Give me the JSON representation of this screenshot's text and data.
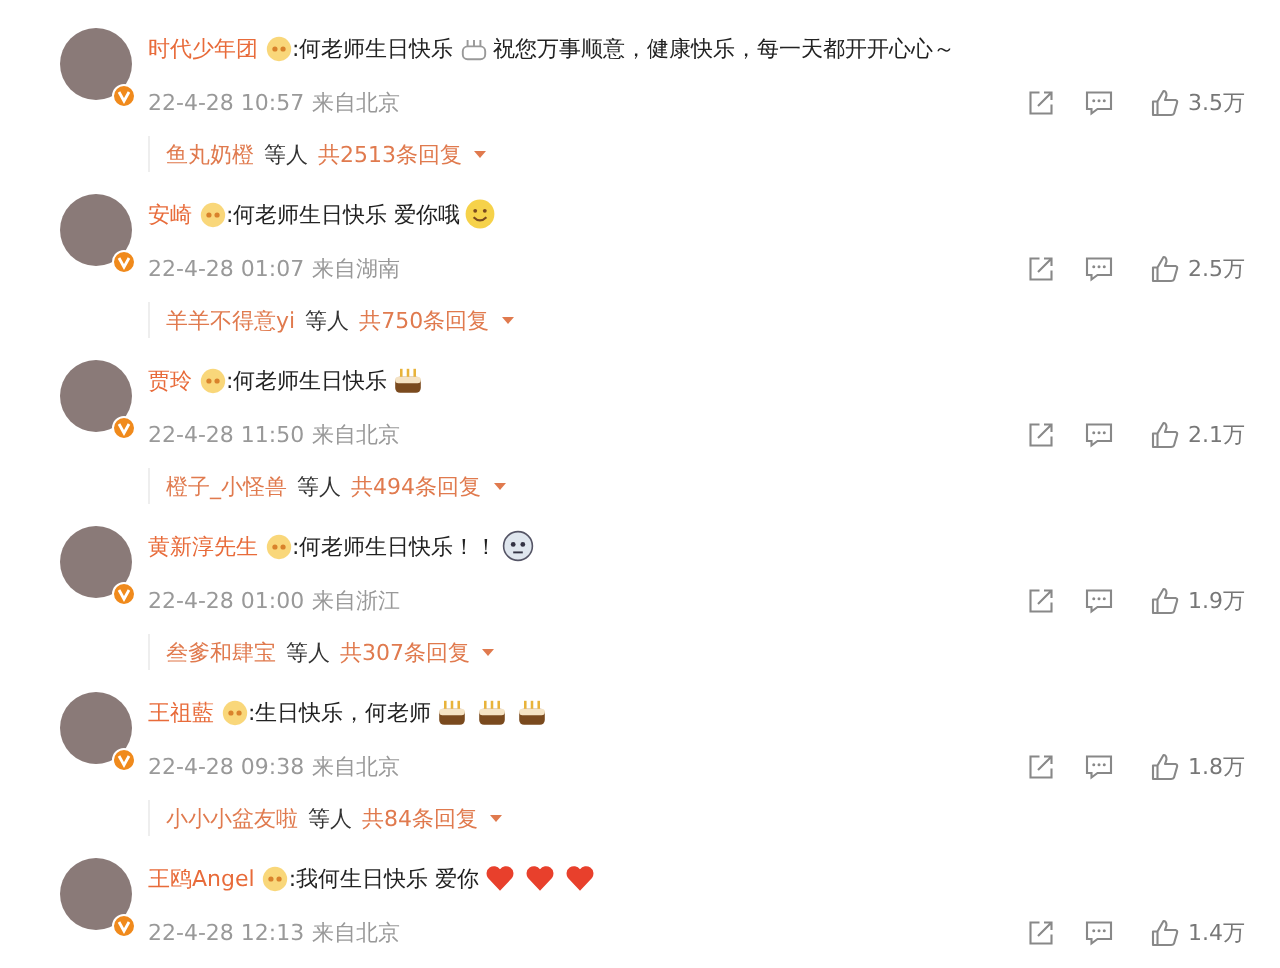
{
  "comments": [
    {
      "name": "时代少年团",
      "content": [
        {
          "kind": "text",
          "text": ":何老师生日快乐"
        },
        {
          "kind": "cakeoutline"
        },
        {
          "kind": "text",
          "text": "祝您万事顺意，健康快乐，每一天都开开心心～"
        }
      ],
      "date": "22-4-28 10:57",
      "location": "来自北京",
      "likes": "3.5万",
      "reply": {
        "names": "鱼丸奶橙",
        "suffix": "等人",
        "total": "共2513条回复"
      }
    },
    {
      "name": "安崎",
      "content": [
        {
          "kind": "text",
          "text": ":何老师生日快乐 爱你哦"
        },
        {
          "kind": "smile"
        }
      ],
      "date": "22-4-28 01:07",
      "location": "来自湖南",
      "likes": "2.5万",
      "reply": {
        "names": "羊羊不得意yi",
        "suffix": "等人",
        "total": "共750条回复"
      }
    },
    {
      "name": "贾玲",
      "content": [
        {
          "kind": "text",
          "text": ":何老师生日快乐"
        },
        {
          "kind": "cake"
        }
      ],
      "date": "22-4-28 11:50",
      "location": "来自北京",
      "likes": "2.1万",
      "reply": {
        "names": "橙子_小怪兽",
        "suffix": "等人",
        "total": "共494条回复"
      }
    },
    {
      "name": "黄新淳先生",
      "content": [
        {
          "kind": "text",
          "text": ":何老师生日快乐！！"
        },
        {
          "kind": "sticker"
        }
      ],
      "date": "22-4-28 01:00",
      "location": "来自浙江",
      "likes": "1.9万",
      "reply": {
        "names": "叁爹和肆宝",
        "suffix": "等人",
        "total": "共307条回复"
      }
    },
    {
      "name": "王祖藍",
      "content": [
        {
          "kind": "text",
          "text": ":生日快乐，何老师"
        },
        {
          "kind": "cake"
        },
        {
          "kind": "cake"
        },
        {
          "kind": "cake"
        }
      ],
      "date": "22-4-28 09:38",
      "location": "来自北京",
      "likes": "1.8万",
      "reply": {
        "names": "小小小盆友啦",
        "suffix": "等人",
        "total": "共84条回复"
      }
    },
    {
      "name": "王鸥Angel",
      "content": [
        {
          "kind": "text",
          "text": ":我何生日快乐 爱你"
        },
        {
          "kind": "heart"
        },
        {
          "kind": "heart"
        },
        {
          "kind": "heart"
        }
      ],
      "date": "22-4-28 12:13",
      "location": "来自北京",
      "likes": "1.4万"
    }
  ]
}
